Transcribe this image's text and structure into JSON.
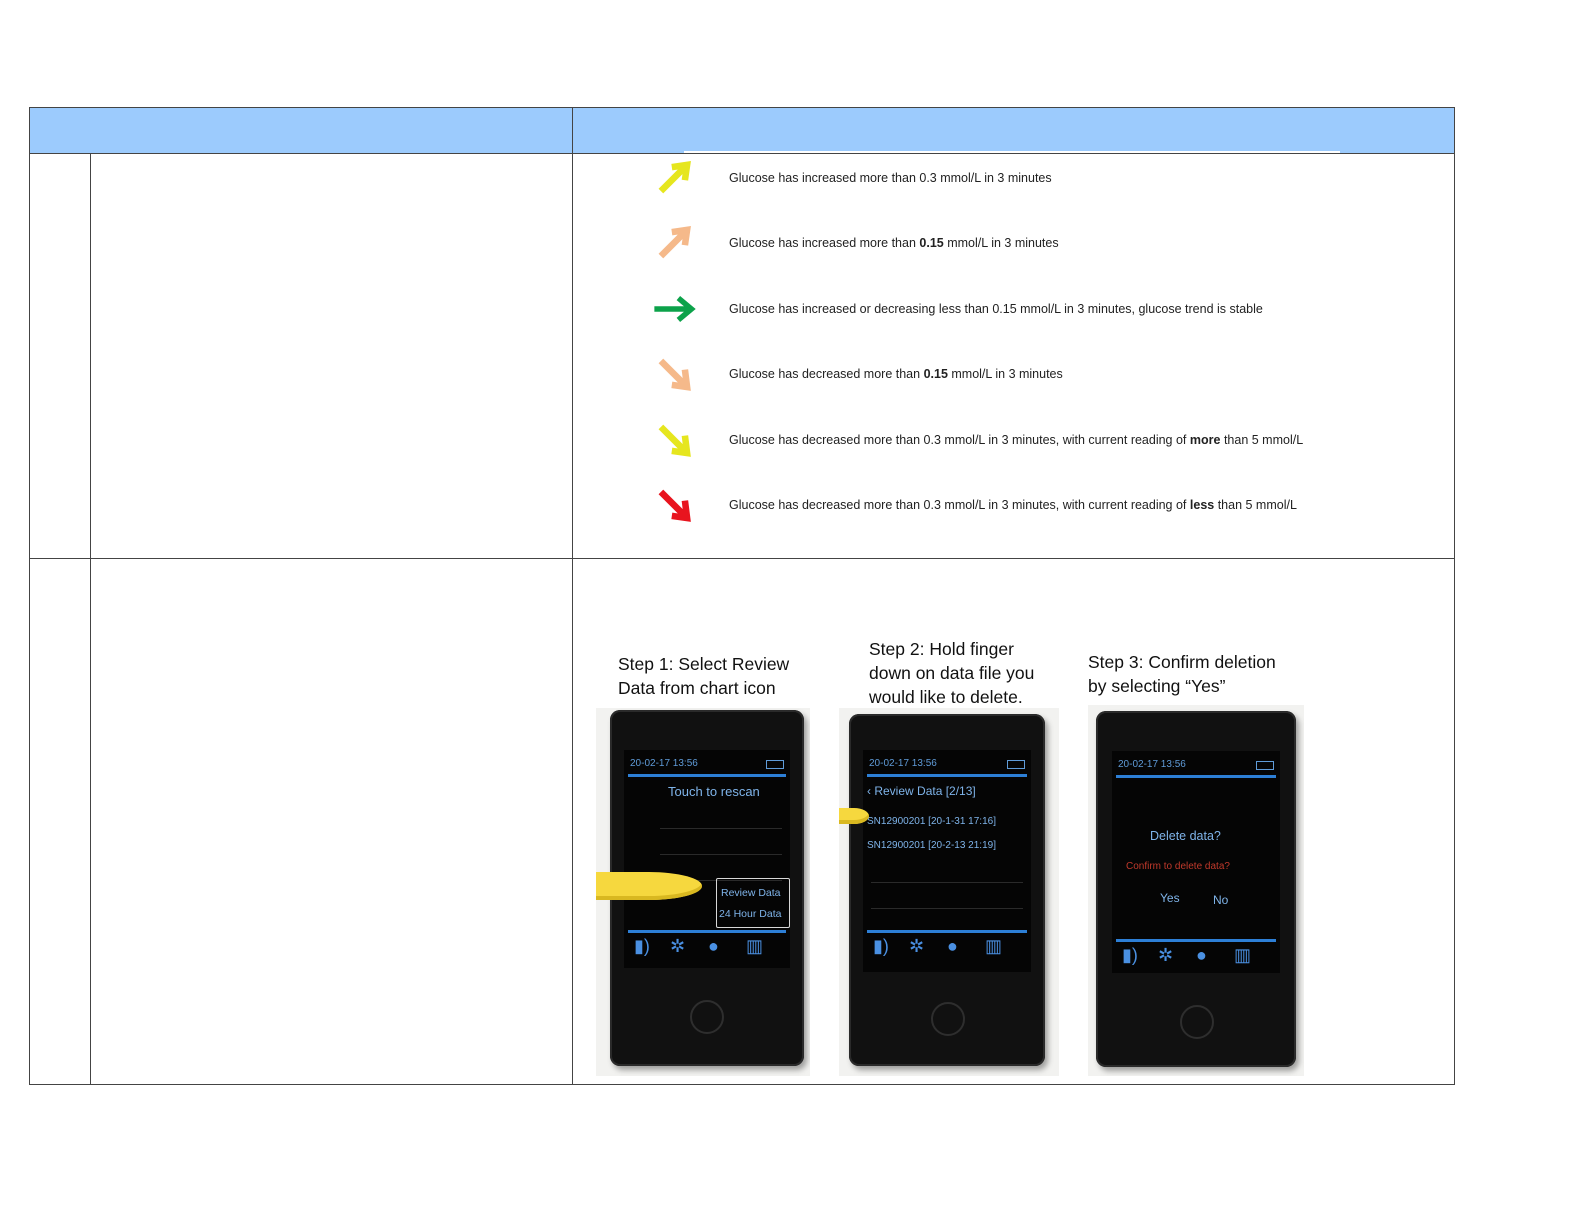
{
  "trend_legend": [
    {
      "arrow_icon": "arrow-up-right-icon",
      "color": "#e6e61e",
      "direction": "up-right",
      "text_before": "Glucose has increased more than 0.3 mmol/L in 3 minutes",
      "bold": "",
      "text_after": ""
    },
    {
      "arrow_icon": "arrow-up-right-icon",
      "color": "#f5b98a",
      "direction": "up-right",
      "text_before": "Glucose has increased more than ",
      "bold": "0.15",
      "text_after": " mmol/L in 3 minutes"
    },
    {
      "arrow_icon": "arrow-right-icon",
      "color": "#0ca24a",
      "direction": "right",
      "text_before": "Glucose has increased or decreasing less than 0.15 mmol/L in 3 minutes, glucose trend is stable",
      "bold": "",
      "text_after": ""
    },
    {
      "arrow_icon": "arrow-down-right-icon",
      "color": "#f5b98a",
      "direction": "down-right",
      "text_before": "Glucose has decreased more than ",
      "bold": "0.15",
      "text_after": " mmol/L in 3 minutes"
    },
    {
      "arrow_icon": "arrow-down-right-icon",
      "color": "#e6e61e",
      "direction": "down-right",
      "text_before": "Glucose has decreased more than 0.3 mmol/L in 3 minutes, with current reading of ",
      "bold": "more",
      "text_after": " than 5 mmol/L"
    },
    {
      "arrow_icon": "arrow-down-right-icon",
      "color": "#e8141e",
      "direction": "down-right",
      "text_before": "Glucose has decreased more than 0.3 mmol/L in 3 minutes, with current reading of ",
      "bold": "less",
      "text_after": " than 5 mmol/L"
    }
  ],
  "steps": [
    {
      "line1": "Step 1: Select Review",
      "line2": "Data from chart icon",
      "line3": ""
    },
    {
      "line1": "Step 2: Hold finger",
      "line2": "down on data file you",
      "line3": "would like to delete."
    },
    {
      "line1": "Step 3: Confirm deletion",
      "line2": "by selecting “Yes”",
      "line3": ""
    }
  ],
  "device_screens": {
    "timestamp": "20-02-17 13:56",
    "screen1": {
      "header": "Touch to rescan",
      "menu_item_1": "Review Data",
      "menu_item_2": "24 Hour Data"
    },
    "screen2": {
      "header": "Review Data  [2/13]",
      "file_1": "SN12900201  [20-1-31  17:16]",
      "file_2": "SN12900201  [20-2-13  21:19]"
    },
    "screen3": {
      "title": "Delete data?",
      "prompt": "Confirm to delete data?",
      "yes": "Yes",
      "no": "No"
    },
    "icons": [
      "sensor-icon",
      "gear-icon",
      "user-icon",
      "chart-icon"
    ]
  }
}
